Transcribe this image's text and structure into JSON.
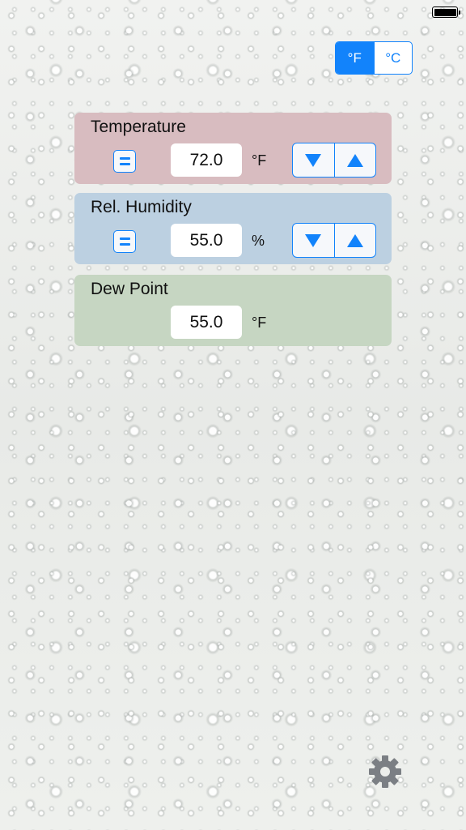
{
  "status_bar": {
    "battery": "full"
  },
  "units": {
    "fahrenheit": "°F",
    "celsius": "°C",
    "selected": "fahrenheit",
    "accent": "#1283fb"
  },
  "temperature": {
    "title": "Temperature",
    "value": "72.0",
    "unit": "°F",
    "card_color": "#d8bcc0"
  },
  "humidity": {
    "title": "Rel. Humidity",
    "value": "55.0",
    "unit": "%",
    "card_color": "#bcd0e1"
  },
  "dew_point": {
    "title": "Dew Point",
    "value": "55.0",
    "unit": "°F",
    "card_color": "#c6d6c2"
  },
  "icons": {
    "equals": "equals-icon",
    "down": "triangle-down-icon",
    "up": "triangle-up-icon",
    "settings": "gear-icon"
  }
}
